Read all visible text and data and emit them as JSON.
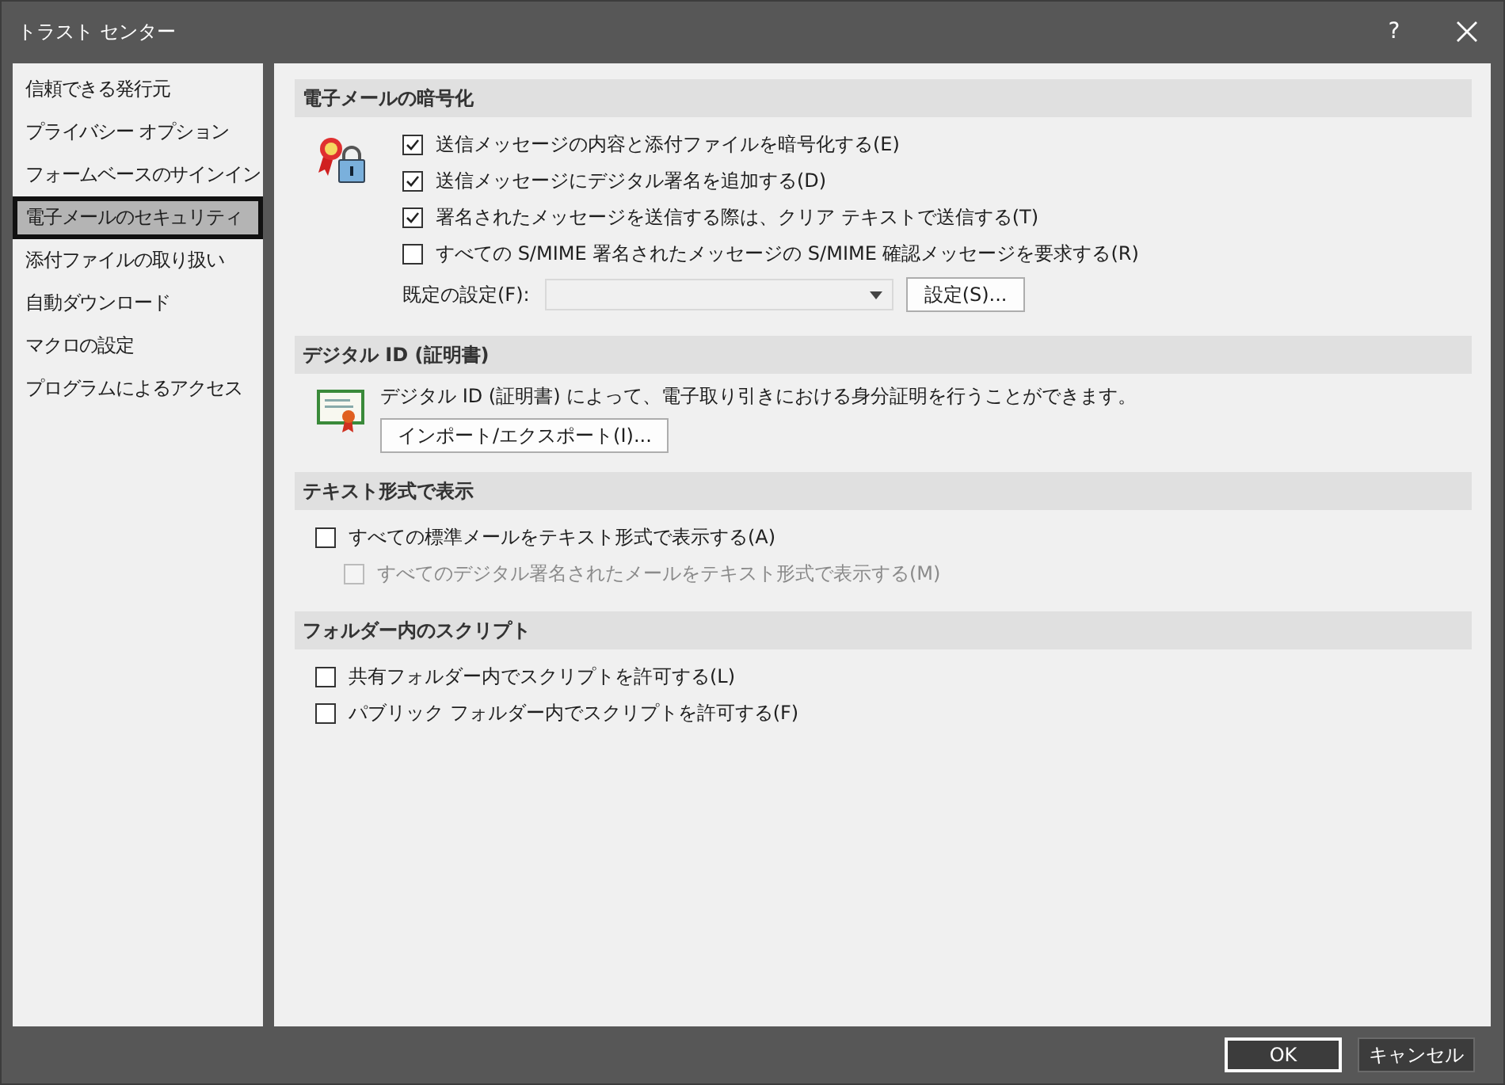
{
  "window": {
    "title": "トラスト センター",
    "help": "?"
  },
  "sidebar": {
    "items": [
      {
        "label": "信頼できる発行元",
        "selected": false
      },
      {
        "label": "プライバシー オプション",
        "selected": false
      },
      {
        "label": "フォームベースのサインイン",
        "selected": false
      },
      {
        "label": "電子メールのセキュリティ",
        "selected": true
      },
      {
        "label": "添付ファイルの取り扱い",
        "selected": false
      },
      {
        "label": "自動ダウンロード",
        "selected": false
      },
      {
        "label": "マクロの設定",
        "selected": false
      },
      {
        "label": "プログラムによるアクセス",
        "selected": false
      }
    ]
  },
  "sections": [
    {
      "kind": "encryption",
      "title": "電子メールの暗号化",
      "options": [
        {
          "label": "送信メッセージの内容と添付ファイルを暗号化する(E)",
          "checked": true,
          "disabled": false
        },
        {
          "label": "送信メッセージにデジタル署名を追加する(D)",
          "checked": true,
          "disabled": false
        },
        {
          "label": "署名されたメッセージを送信する際は、クリア テキストで送信する(T)",
          "checked": true,
          "disabled": false
        },
        {
          "label": "すべての S/MIME 署名されたメッセージの S/MIME 確認メッセージを要求する(R)",
          "checked": false,
          "disabled": false
        }
      ],
      "default_setting": {
        "label": "既定の設定(F):"
      },
      "button": "設定(S)..."
    },
    {
      "kind": "digital_id",
      "title": "デジタル ID (証明書)",
      "description": "デジタル ID (証明書) によって、電子取り引きにおける身分証明を行うことができます。",
      "button": "インポート/エクスポート(I)..."
    },
    {
      "kind": "options",
      "title": "テキスト形式で表示",
      "options": [
        {
          "label": "すべての標準メールをテキスト形式で表示する(A)",
          "checked": false,
          "disabled": false,
          "children": [
            {
              "label": "すべてのデジタル署名されたメールをテキスト形式で表示する(M)",
              "checked": false,
              "disabled": true
            }
          ]
        }
      ]
    },
    {
      "kind": "options",
      "title": "フォルダー内のスクリプト",
      "options": [
        {
          "label": "共有フォルダー内でスクリプトを許可する(L)",
          "checked": false,
          "disabled": false
        },
        {
          "label": "パブリック フォルダー内でスクリプトを許可する(F)",
          "checked": false,
          "disabled": false
        }
      ]
    }
  ],
  "buttons": [
    {
      "label": "OK",
      "default": true
    },
    {
      "label": "キャンセル",
      "default": false
    }
  ]
}
